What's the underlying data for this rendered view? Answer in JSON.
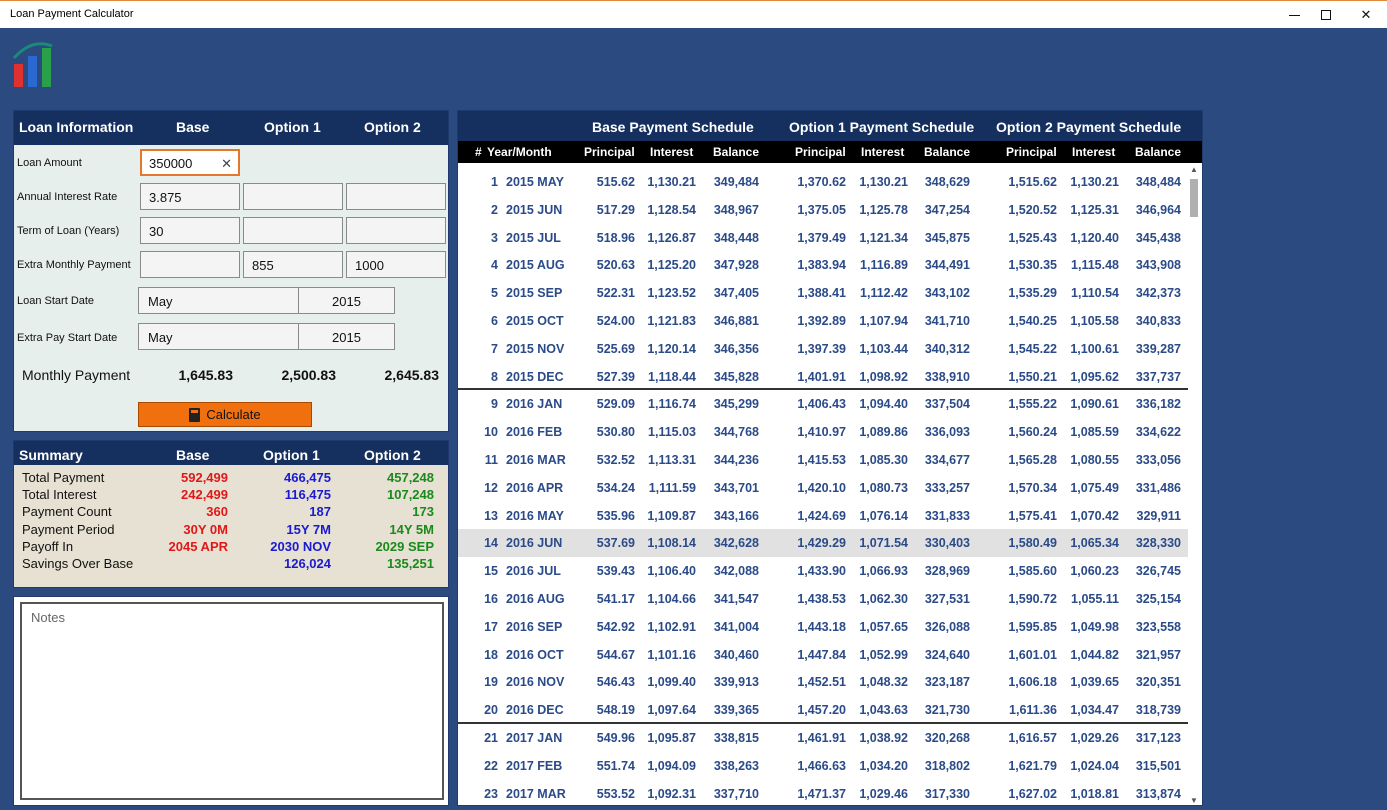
{
  "window": {
    "title": "Loan Payment Calculator",
    "minimize_glyph": "—",
    "close_glyph": "✕"
  },
  "loan_info": {
    "header": {
      "title": "Loan Information",
      "base": "Base",
      "opt1": "Option 1",
      "opt2": "Option 2"
    },
    "labels": {
      "loan_amount": "Loan Amount",
      "interest_rate": "Annual Interest Rate",
      "term": "Term of Loan (Years)",
      "extra_payment": "Extra Monthly Payment",
      "start_date": "Loan Start Date",
      "extra_start_date": "Extra Pay Start Date",
      "monthly_payment": "Monthly Payment"
    },
    "loan_amount": "350000",
    "interest_rate": {
      "base": "3.875",
      "opt1": "",
      "opt2": ""
    },
    "term": {
      "base": "30",
      "opt1": "",
      "opt2": ""
    },
    "extra_payment": {
      "base": "",
      "opt1": "855",
      "opt2": "1000"
    },
    "start_date": {
      "month": "May",
      "year": "2015"
    },
    "extra_start_date": {
      "month": "May",
      "year": "2015"
    },
    "monthly_payment": {
      "base": "1,645.83",
      "opt1": "2,500.83",
      "opt2": "2,645.83"
    },
    "calculate_label": "Calculate",
    "clear_glyph": "✕"
  },
  "summary": {
    "header": {
      "title": "Summary",
      "base": "Base",
      "opt1": "Option 1",
      "opt2": "Option 2"
    },
    "rows": [
      {
        "label": "Total Payment",
        "base": "592,499",
        "opt1": "466,475",
        "opt2": "457,248"
      },
      {
        "label": "Total Interest",
        "base": "242,499",
        "opt1": "116,475",
        "opt2": "107,248"
      },
      {
        "label": "Payment Count",
        "base": "360",
        "opt1": "187",
        "opt2": "173"
      },
      {
        "label": "Payment Period",
        "base": "30Y 0M",
        "opt1": "15Y 7M",
        "opt2": "14Y 5M"
      },
      {
        "label": "Payoff In",
        "base": "2045 APR",
        "opt1": "2030 NOV",
        "opt2": "2029 SEP"
      },
      {
        "label": "Savings Over Base",
        "base": "",
        "opt1": "126,024",
        "opt2": "135,251"
      }
    ],
    "colors": {
      "base": "#e01818",
      "opt1": "#1a1ad0",
      "opt2": "#1a8a1a"
    }
  },
  "notes": {
    "placeholder": "Notes"
  },
  "schedule": {
    "titles": {
      "base": "Base Payment Schedule",
      "opt1": "Option 1 Payment Schedule",
      "opt2": "Option 2 Payment Schedule"
    },
    "columns": {
      "num": "#",
      "ym": "Year/Month",
      "principal": "Principal",
      "interest": "Interest",
      "balance": "Balance"
    },
    "selected_row": 14,
    "rows": [
      [
        "1",
        "2015 MAY",
        "515.62",
        "1,130.21",
        "349,484",
        "1,370.62",
        "1,130.21",
        "348,629",
        "1,515.62",
        "1,130.21",
        "348,484"
      ],
      [
        "2",
        "2015 JUN",
        "517.29",
        "1,128.54",
        "348,967",
        "1,375.05",
        "1,125.78",
        "347,254",
        "1,520.52",
        "1,125.31",
        "346,964"
      ],
      [
        "3",
        "2015 JUL",
        "518.96",
        "1,126.87",
        "348,448",
        "1,379.49",
        "1,121.34",
        "345,875",
        "1,525.43",
        "1,120.40",
        "345,438"
      ],
      [
        "4",
        "2015 AUG",
        "520.63",
        "1,125.20",
        "347,928",
        "1,383.94",
        "1,116.89",
        "344,491",
        "1,530.35",
        "1,115.48",
        "343,908"
      ],
      [
        "5",
        "2015 SEP",
        "522.31",
        "1,123.52",
        "347,405",
        "1,388.41",
        "1,112.42",
        "343,102",
        "1,535.29",
        "1,110.54",
        "342,373"
      ],
      [
        "6",
        "2015 OCT",
        "524.00",
        "1,121.83",
        "346,881",
        "1,392.89",
        "1,107.94",
        "341,710",
        "1,540.25",
        "1,105.58",
        "340,833"
      ],
      [
        "7",
        "2015 NOV",
        "525.69",
        "1,120.14",
        "346,356",
        "1,397.39",
        "1,103.44",
        "340,312",
        "1,545.22",
        "1,100.61",
        "339,287"
      ],
      [
        "8",
        "2015 DEC",
        "527.39",
        "1,118.44",
        "345,828",
        "1,401.91",
        "1,098.92",
        "338,910",
        "1,550.21",
        "1,095.62",
        "337,737"
      ],
      [
        "9",
        "2016 JAN",
        "529.09",
        "1,116.74",
        "345,299",
        "1,406.43",
        "1,094.40",
        "337,504",
        "1,555.22",
        "1,090.61",
        "336,182"
      ],
      [
        "10",
        "2016 FEB",
        "530.80",
        "1,115.03",
        "344,768",
        "1,410.97",
        "1,089.86",
        "336,093",
        "1,560.24",
        "1,085.59",
        "334,622"
      ],
      [
        "11",
        "2016 MAR",
        "532.52",
        "1,113.31",
        "344,236",
        "1,415.53",
        "1,085.30",
        "334,677",
        "1,565.28",
        "1,080.55",
        "333,056"
      ],
      [
        "12",
        "2016 APR",
        "534.24",
        "1,111.59",
        "343,701",
        "1,420.10",
        "1,080.73",
        "333,257",
        "1,570.34",
        "1,075.49",
        "331,486"
      ],
      [
        "13",
        "2016 MAY",
        "535.96",
        "1,109.87",
        "343,166",
        "1,424.69",
        "1,076.14",
        "331,833",
        "1,575.41",
        "1,070.42",
        "329,911"
      ],
      [
        "14",
        "2016 JUN",
        "537.69",
        "1,108.14",
        "342,628",
        "1,429.29",
        "1,071.54",
        "330,403",
        "1,580.49",
        "1,065.34",
        "328,330"
      ],
      [
        "15",
        "2016 JUL",
        "539.43",
        "1,106.40",
        "342,088",
        "1,433.90",
        "1,066.93",
        "328,969",
        "1,585.60",
        "1,060.23",
        "326,745"
      ],
      [
        "16",
        "2016 AUG",
        "541.17",
        "1,104.66",
        "341,547",
        "1,438.53",
        "1,062.30",
        "327,531",
        "1,590.72",
        "1,055.11",
        "325,154"
      ],
      [
        "17",
        "2016 SEP",
        "542.92",
        "1,102.91",
        "341,004",
        "1,443.18",
        "1,057.65",
        "326,088",
        "1,595.85",
        "1,049.98",
        "323,558"
      ],
      [
        "18",
        "2016 OCT",
        "544.67",
        "1,101.16",
        "340,460",
        "1,447.84",
        "1,052.99",
        "324,640",
        "1,601.01",
        "1,044.82",
        "321,957"
      ],
      [
        "19",
        "2016 NOV",
        "546.43",
        "1,099.40",
        "339,913",
        "1,452.51",
        "1,048.32",
        "323,187",
        "1,606.18",
        "1,039.65",
        "320,351"
      ],
      [
        "20",
        "2016 DEC",
        "548.19",
        "1,097.64",
        "339,365",
        "1,457.20",
        "1,043.63",
        "321,730",
        "1,611.36",
        "1,034.47",
        "318,739"
      ],
      [
        "21",
        "2017 JAN",
        "549.96",
        "1,095.87",
        "338,815",
        "1,461.91",
        "1,038.92",
        "320,268",
        "1,616.57",
        "1,029.26",
        "317,123"
      ],
      [
        "22",
        "2017 FEB",
        "551.74",
        "1,094.09",
        "338,263",
        "1,466.63",
        "1,034.20",
        "318,802",
        "1,621.79",
        "1,024.04",
        "315,501"
      ],
      [
        "23",
        "2017 MAR",
        "553.52",
        "1,092.31",
        "337,710",
        "1,471.37",
        "1,029.46",
        "317,330",
        "1,627.02",
        "1,018.81",
        "313,874"
      ]
    ]
  }
}
